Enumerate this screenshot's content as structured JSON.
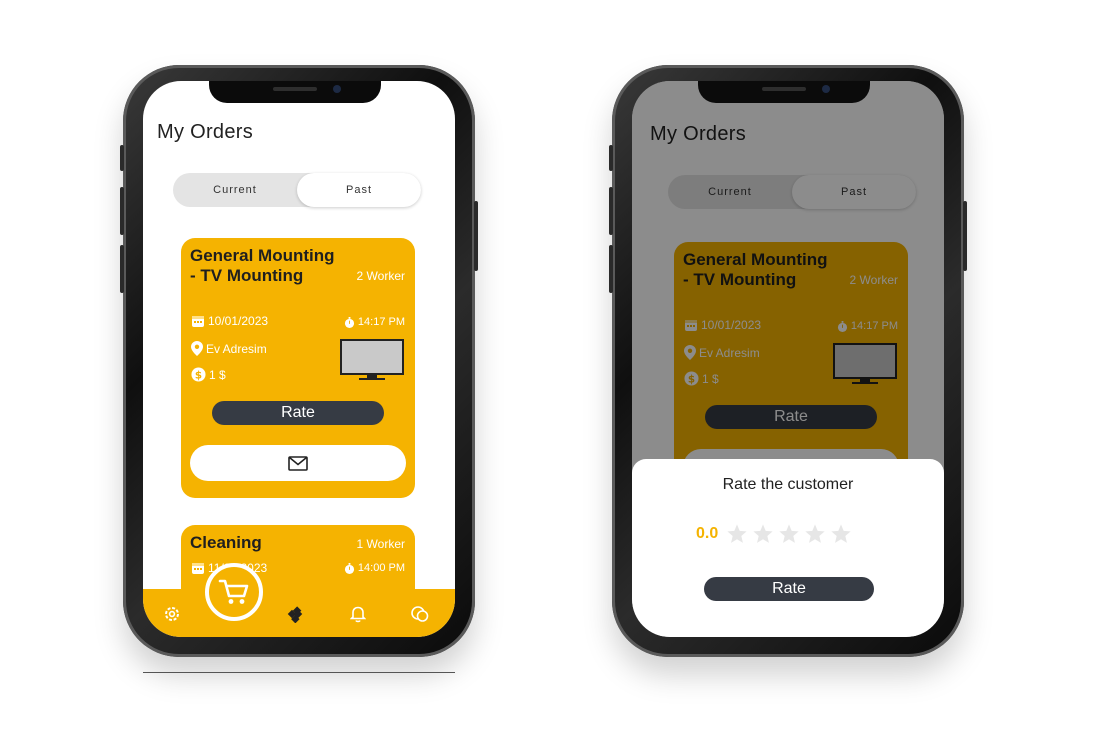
{
  "screens": [
    {
      "title": "My Orders",
      "tabs": [
        "Current",
        "Past"
      ],
      "orders": [
        {
          "title": "General Mounting - TV Mounting",
          "workers": "2 Worker",
          "date": "10/01/2023",
          "time": "14:17 PM",
          "address": "Ev Adresim",
          "price": "1 $",
          "rate_label": "Rate"
        },
        {
          "title": "Cleaning",
          "workers": "1 Worker",
          "date": "11/01/2023",
          "time": "14:00 PM"
        }
      ],
      "nav": [
        "settings-icon",
        "apps-icon",
        "cart-icon",
        "bell-icon",
        "chat-icon"
      ]
    },
    {
      "title": "My Orders",
      "tabs": [
        "Current",
        "Past"
      ],
      "orders": [
        {
          "title": "General Mounting - TV Mounting",
          "workers": "2 Worker",
          "date": "10/01/2023",
          "time": "14:17 PM",
          "address": "Ev Adresim",
          "price": "1 $",
          "rate_label": "Rate"
        }
      ],
      "dialog": {
        "title": "Rate the customer",
        "rating": "0.0",
        "stars_total": 5,
        "stars_filled": 0,
        "button": "Rate"
      }
    }
  ],
  "colors": {
    "accent": "#f5b301",
    "dark_button": "#363b44",
    "star_empty": "#e6e6e6"
  }
}
